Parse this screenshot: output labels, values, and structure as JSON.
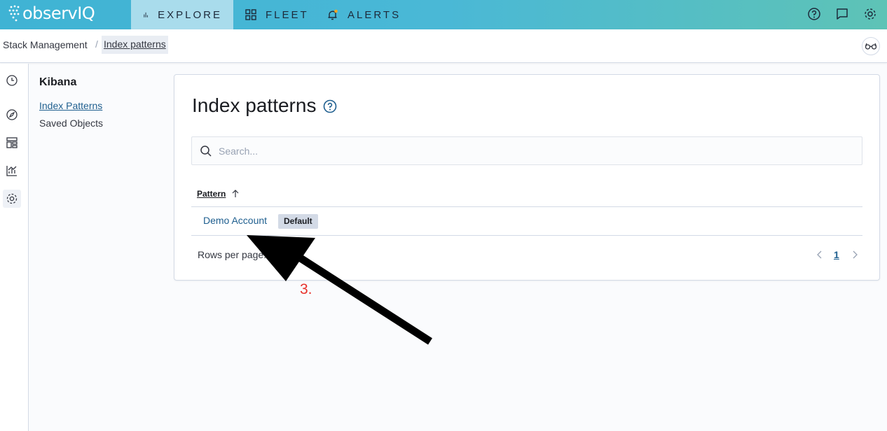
{
  "topbar": {
    "logo_text": "observIQ",
    "tabs": [
      {
        "label": "EXPLORE",
        "icon": "bar-chart-icon"
      },
      {
        "label": "FLEET",
        "icon": "grid-icon"
      },
      {
        "label": "ALERTS",
        "icon": "bell-icon"
      }
    ],
    "icons": [
      "help-icon",
      "chat-icon",
      "gear-icon"
    ]
  },
  "breadcrumb": {
    "items": [
      "Stack Management",
      "Index patterns"
    ],
    "separator": "/"
  },
  "sidenav": {
    "title": "Kibana",
    "items": [
      "Index Patterns",
      "Saved Objects"
    ]
  },
  "main": {
    "title": "Index patterns",
    "search_placeholder": "Search...",
    "table": {
      "column_header": "Pattern",
      "rows": [
        {
          "name": "Demo Account",
          "badge": "Default"
        }
      ]
    },
    "rows_per_page_label": "Rows per page:",
    "current_page": "1"
  },
  "annotation": {
    "step_label": "3."
  },
  "colors": {
    "topbar_start": "#3fb3d4",
    "topbar_end": "#5ec3b6",
    "link": "#1f5f8f",
    "annotation": "#e8322b"
  }
}
